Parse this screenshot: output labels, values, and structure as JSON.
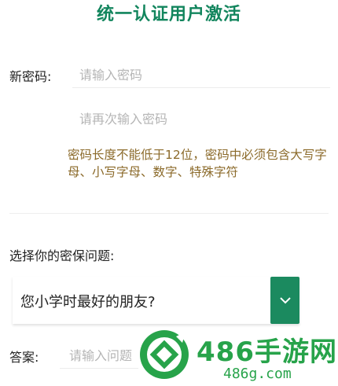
{
  "page": {
    "title": "统一认证用户激活"
  },
  "form": {
    "new_password_label": "新密码:",
    "new_password_placeholder": "请输入密码",
    "confirm_password_placeholder": "请再次输入密码",
    "password_hint": "密码长度不能低于12位，密码中必须包含大写字母、小写字母、数字、特殊字符",
    "security_question_label": "选择你的密保问题:",
    "security_question_selected": "您小学时最好的朋友?",
    "answer_label": "答案:",
    "answer_placeholder": "请输入问题"
  },
  "colors": {
    "accent": "#12855d",
    "hint": "#8b6a2a",
    "dropdown": "#1b8a5f",
    "watermark": "#27a34a"
  },
  "icons": {
    "dropdown": "chevron-down-icon",
    "watermark_logo": "486-logo-icon"
  },
  "watermark": {
    "brand": "486手游网",
    "url": "486g.com"
  }
}
